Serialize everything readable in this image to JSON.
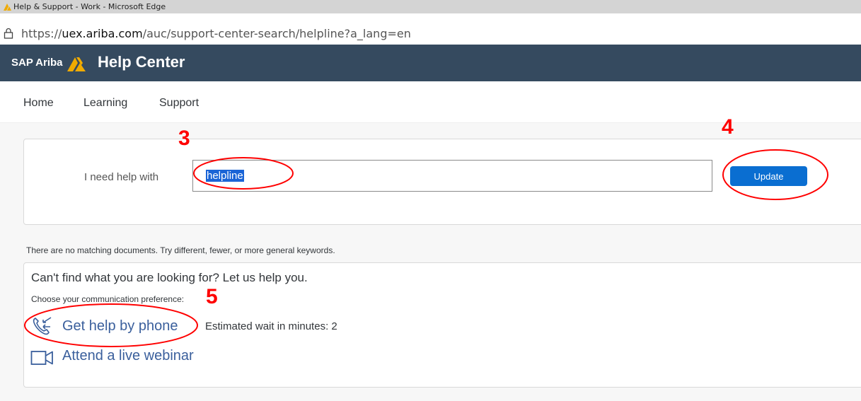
{
  "window": {
    "title": "Help & Support - Work - Microsoft Edge",
    "icon": "warning-icon"
  },
  "address_bar": {
    "protocol": "https://",
    "domain": "uex.ariba.com",
    "path": "/auc/support-center-search/helpline?a_lang=en"
  },
  "header": {
    "brand": "SAP Ariba",
    "title": "Help Center",
    "background": "#354a5f",
    "accent": "#f0ab00"
  },
  "nav": {
    "items": [
      {
        "label": "Home"
      },
      {
        "label": "Learning"
      },
      {
        "label": "Support"
      }
    ]
  },
  "search": {
    "label": "I need help with",
    "value": "helpline",
    "button_label": "Update"
  },
  "results": {
    "message": "There are no matching documents. Try different, fewer, or more general keywords."
  },
  "help": {
    "heading": "Can't find what you are looking for? Let us help you.",
    "preference_label": "Choose your communication preference:",
    "phone_label": "Get help by phone",
    "phone_icon": "phone-callback-icon",
    "wait_text": "Estimated wait in minutes: 2",
    "webinar_label": "Attend a live webinar",
    "webinar_icon": "video-camera-icon"
  },
  "annotations": {
    "step3": "3",
    "step4": "4",
    "step5": "5",
    "color": "#ff0000"
  }
}
